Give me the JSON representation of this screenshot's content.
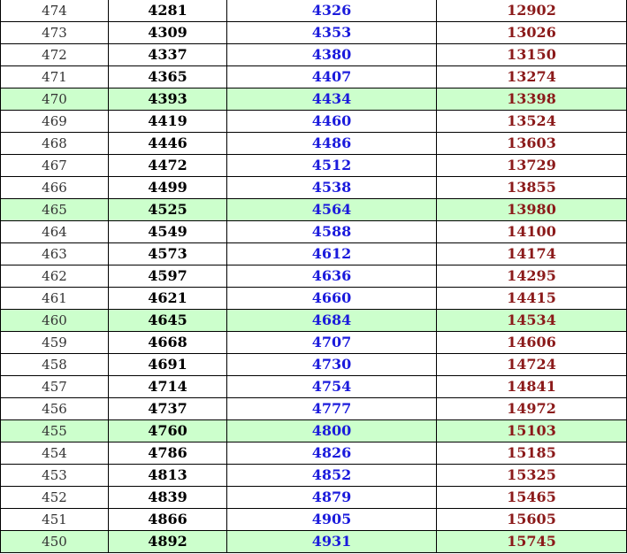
{
  "colors": {
    "highlight_row_bg": "#ccffcc",
    "score_text": "#333333",
    "col_a_text": "#000000",
    "col_b_text": "#1a1adc",
    "col_c_text": "#8b1a1a",
    "border": "#000000"
  },
  "rows": [
    {
      "score": "474",
      "a": "4281",
      "b": "4326",
      "c": "12902",
      "highlight": false
    },
    {
      "score": "473",
      "a": "4309",
      "b": "4353",
      "c": "13026",
      "highlight": false
    },
    {
      "score": "472",
      "a": "4337",
      "b": "4380",
      "c": "13150",
      "highlight": false
    },
    {
      "score": "471",
      "a": "4365",
      "b": "4407",
      "c": "13274",
      "highlight": false
    },
    {
      "score": "470",
      "a": "4393",
      "b": "4434",
      "c": "13398",
      "highlight": true
    },
    {
      "score": "469",
      "a": "4419",
      "b": "4460",
      "c": "13524",
      "highlight": false
    },
    {
      "score": "468",
      "a": "4446",
      "b": "4486",
      "c": "13603",
      "highlight": false
    },
    {
      "score": "467",
      "a": "4472",
      "b": "4512",
      "c": "13729",
      "highlight": false
    },
    {
      "score": "466",
      "a": "4499",
      "b": "4538",
      "c": "13855",
      "highlight": false
    },
    {
      "score": "465",
      "a": "4525",
      "b": "4564",
      "c": "13980",
      "highlight": true
    },
    {
      "score": "464",
      "a": "4549",
      "b": "4588",
      "c": "14100",
      "highlight": false
    },
    {
      "score": "463",
      "a": "4573",
      "b": "4612",
      "c": "14174",
      "highlight": false
    },
    {
      "score": "462",
      "a": "4597",
      "b": "4636",
      "c": "14295",
      "highlight": false
    },
    {
      "score": "461",
      "a": "4621",
      "b": "4660",
      "c": "14415",
      "highlight": false
    },
    {
      "score": "460",
      "a": "4645",
      "b": "4684",
      "c": "14534",
      "highlight": true
    },
    {
      "score": "459",
      "a": "4668",
      "b": "4707",
      "c": "14606",
      "highlight": false
    },
    {
      "score": "458",
      "a": "4691",
      "b": "4730",
      "c": "14724",
      "highlight": false
    },
    {
      "score": "457",
      "a": "4714",
      "b": "4754",
      "c": "14841",
      "highlight": false
    },
    {
      "score": "456",
      "a": "4737",
      "b": "4777",
      "c": "14972",
      "highlight": false
    },
    {
      "score": "455",
      "a": "4760",
      "b": "4800",
      "c": "15103",
      "highlight": true
    },
    {
      "score": "454",
      "a": "4786",
      "b": "4826",
      "c": "15185",
      "highlight": false
    },
    {
      "score": "453",
      "a": "4813",
      "b": "4852",
      "c": "15325",
      "highlight": false
    },
    {
      "score": "452",
      "a": "4839",
      "b": "4879",
      "c": "15465",
      "highlight": false
    },
    {
      "score": "451",
      "a": "4866",
      "b": "4905",
      "c": "15605",
      "highlight": false
    },
    {
      "score": "450",
      "a": "4892",
      "b": "4931",
      "c": "15745",
      "highlight": true
    }
  ]
}
